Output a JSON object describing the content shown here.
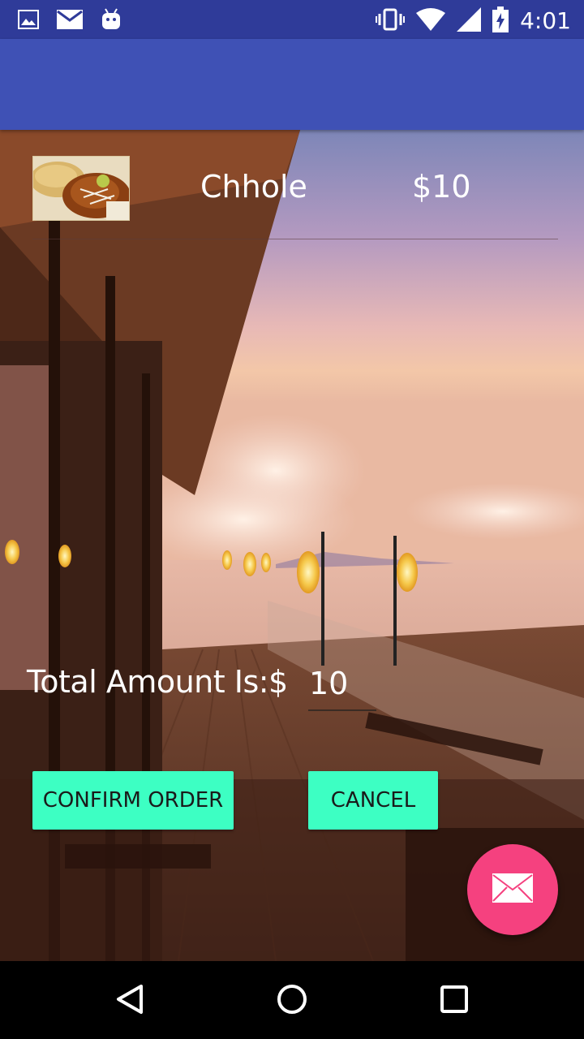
{
  "status_bar": {
    "time": "4:01",
    "left_icons": [
      "image-icon",
      "mail-icon",
      "android-icon"
    ],
    "right_icons": [
      "vibrate-icon",
      "wifi-icon",
      "signal-icon",
      "battery-charging-icon"
    ]
  },
  "app_bar": {
    "title": ""
  },
  "order_item": {
    "name": "Chhole",
    "price": "$10",
    "image": "chhole-dish-thumbnail"
  },
  "total": {
    "label": "Total Amount Is:$",
    "value": "10"
  },
  "buttons": {
    "confirm_label": "CONFIRM ORDER",
    "cancel_label": "CANCEL"
  },
  "fab": {
    "icon": "mail-icon"
  },
  "navigation_bar": {
    "icons": [
      "back-icon",
      "home-icon",
      "recents-icon"
    ]
  },
  "colors": {
    "status_bar": "#2f3b99",
    "app_bar": "#3f51b5",
    "button": "#3dffc3",
    "fab": "#f5417f"
  }
}
